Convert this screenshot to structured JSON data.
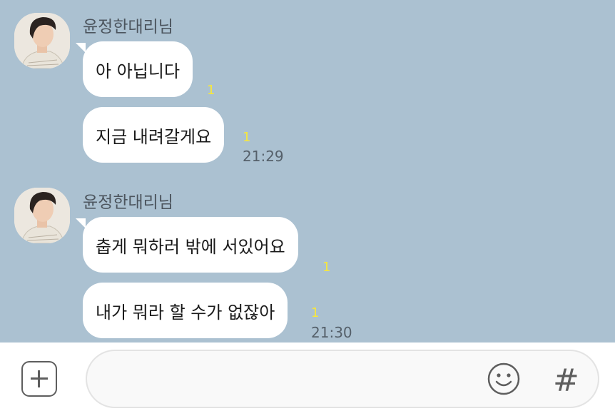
{
  "chat": {
    "groups": [
      {
        "sender": "윤정한대리님",
        "messages": [
          {
            "text": "아 아닙니다",
            "unread": "1",
            "time": ""
          },
          {
            "text": "지금 내려갈게요",
            "unread": "1",
            "time": "21:29"
          }
        ]
      },
      {
        "sender": "윤정한대리님",
        "messages": [
          {
            "text": "춥게 뭐하러 밖에 서있어요",
            "unread": "1",
            "time": ""
          },
          {
            "text": "내가 뭐라 할 수가 없잖아",
            "unread": "1",
            "time": "21:30"
          }
        ]
      }
    ]
  },
  "composer": {
    "input_value": "",
    "add_icon": "plus-square-icon",
    "emoji_icon": "smiley-icon",
    "hashtag_label": "#"
  },
  "colors": {
    "background": "#abc1d1",
    "bubble": "#ffffff",
    "unread": "#f8e83a"
  }
}
